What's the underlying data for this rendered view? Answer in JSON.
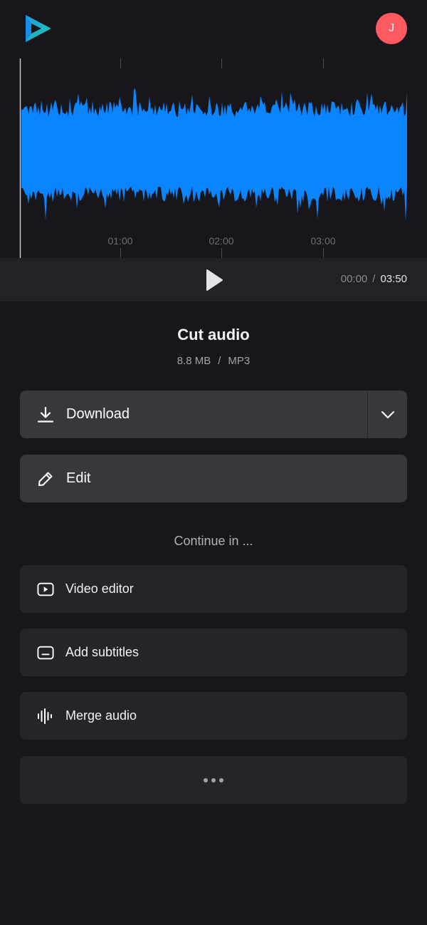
{
  "header": {
    "logo_icon": "play-logo-icon",
    "avatar_initial": "J",
    "avatar_color": "#ff5a5f"
  },
  "waveform": {
    "color": "#0a84ff",
    "timeline_labels": [
      "01:00",
      "02:00",
      "03:00"
    ]
  },
  "player": {
    "play_icon": "play-icon",
    "current_time": "00:00",
    "separator": "/",
    "total_time": "03:50"
  },
  "file": {
    "title": "Cut audio",
    "size": "8.8 MB",
    "separator": "/",
    "format": "MP3"
  },
  "actions": {
    "download_label": "Download",
    "download_icon": "download-icon",
    "download_menu_icon": "chevron-down-icon",
    "edit_label": "Edit",
    "edit_icon": "pencil-icon"
  },
  "continue": {
    "heading": "Continue in ...",
    "items": [
      {
        "label": "Video editor",
        "icon": "video-icon"
      },
      {
        "label": "Add subtitles",
        "icon": "subtitles-icon"
      },
      {
        "label": "Merge audio",
        "icon": "waveform-icon"
      }
    ],
    "more_icon": "more-dots-icon"
  }
}
